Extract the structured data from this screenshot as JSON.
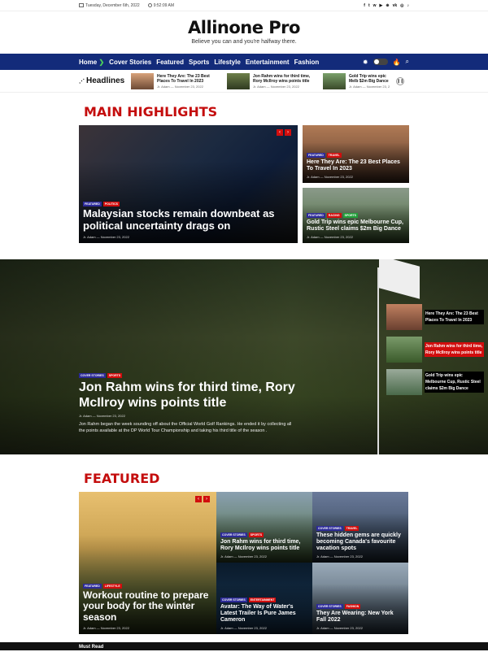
{
  "topbar": {
    "date": "Tuesday, December 6th, 2022",
    "time": "9:52:09 AM",
    "social": [
      "f",
      "t",
      "w",
      "▶",
      "⊕",
      "vk",
      "◎",
      "♪"
    ]
  },
  "brand": {
    "logo": "Allinone Pro",
    "tagline": "Believe you can and you're halfway there."
  },
  "nav": {
    "items": [
      "Home",
      "Cover Stories",
      "Featured",
      "Sports",
      "Lifestyle",
      "Entertainment",
      "Fashion"
    ],
    "active": "Home"
  },
  "headlines": {
    "label": "Headlines",
    "items": [
      {
        "title": "Here They Are: The 23 Best Places To Travel In 2023",
        "author": "Jr. Adam",
        "date": "November 23, 2022"
      },
      {
        "title": "Jon Rahm wins for third time, Rory McIlroy wins points title",
        "author": "Jr. Adam",
        "date": "November 23, 2022"
      },
      {
        "title": "Gold Trip wins epic Melb $2m Big Dance",
        "author": "Jr. Adam",
        "date": "November 23, 2"
      }
    ]
  },
  "main_highlights": {
    "title": "MAIN HIGHLIGHTS",
    "lead": {
      "badges": [
        "FEATURED",
        "POLITICS"
      ],
      "title": "Malaysian stocks remain downbeat as political uncertainty drags on",
      "author": "Jr. Adam",
      "date": "November 23, 2022"
    },
    "side": [
      {
        "badges": [
          "FEATURED",
          "TRAVEL"
        ],
        "title": "Here They Are: The 23 Best Places To Travel In 2023",
        "author": "Jr. Adam",
        "date": "November 23, 2022"
      },
      {
        "badges": [
          "FEATURED",
          "RACING",
          "SPORTS"
        ],
        "title": "Gold Trip wins epic Melbourne Cup, Rustic Steel claims $2m Big Dance",
        "author": "Jr. Adam",
        "date": "November 23, 2022"
      }
    ]
  },
  "hero": {
    "badges": [
      "COVER STORIES",
      "SPORTS"
    ],
    "title": "Jon Rahm wins for third time, Rory McIlroy wins points title",
    "author": "Jr. Adam",
    "date": "November 23, 2022",
    "excerpt": "Jon Rahm began the week sounding off about the Official World Golf Rankings. He ended it by collecting all the points available at the DP World Tour Championship and taking his third title of the season .",
    "list": [
      {
        "title": "Here They Are: The 23 Best Places To Travel In 2023"
      },
      {
        "title": "Jon Rahm wins for third time, Rory McIlroy wins points title"
      },
      {
        "title": "Gold Trip wins epic Melbourne Cup, Rustic Steel claims $2m Big Dance"
      }
    ]
  },
  "featured": {
    "title": "FEATURED",
    "lead": {
      "badges": [
        "FEATURED",
        "LIFESTYLE"
      ],
      "title": "Workout routine to prepare your body for the winter season",
      "author": "Jr. Adam",
      "date": "November 23, 2022"
    },
    "grid": [
      {
        "badges": [
          "COVER STORIES",
          "SPORTS"
        ],
        "title": "Jon Rahm wins for third time, Rory McIlroy wins points title",
        "author": "Jr. Adam",
        "date": "November 23, 2022"
      },
      {
        "badges": [
          "COVER STORIES",
          "TRAVEL"
        ],
        "title": "These hidden gems are quickly becoming Canada's favourite vacation spots",
        "author": "Jr. Adam",
        "date": "November 23, 2022"
      },
      {
        "badges": [
          "COVER STORIES",
          "ENTERTAINMENT"
        ],
        "title": "Avatar: The Way of Water's Latest Trailer Is Pure James Cameron",
        "author": "Jr. Adam",
        "date": "November 23, 2022"
      },
      {
        "badges": [
          "COVER STORIES",
          "FASHION"
        ],
        "title": "They Are Wearing: New York Fall 2022",
        "author": "Jr. Adam",
        "date": "November 23, 2022"
      }
    ]
  },
  "must_read": "Must Read"
}
